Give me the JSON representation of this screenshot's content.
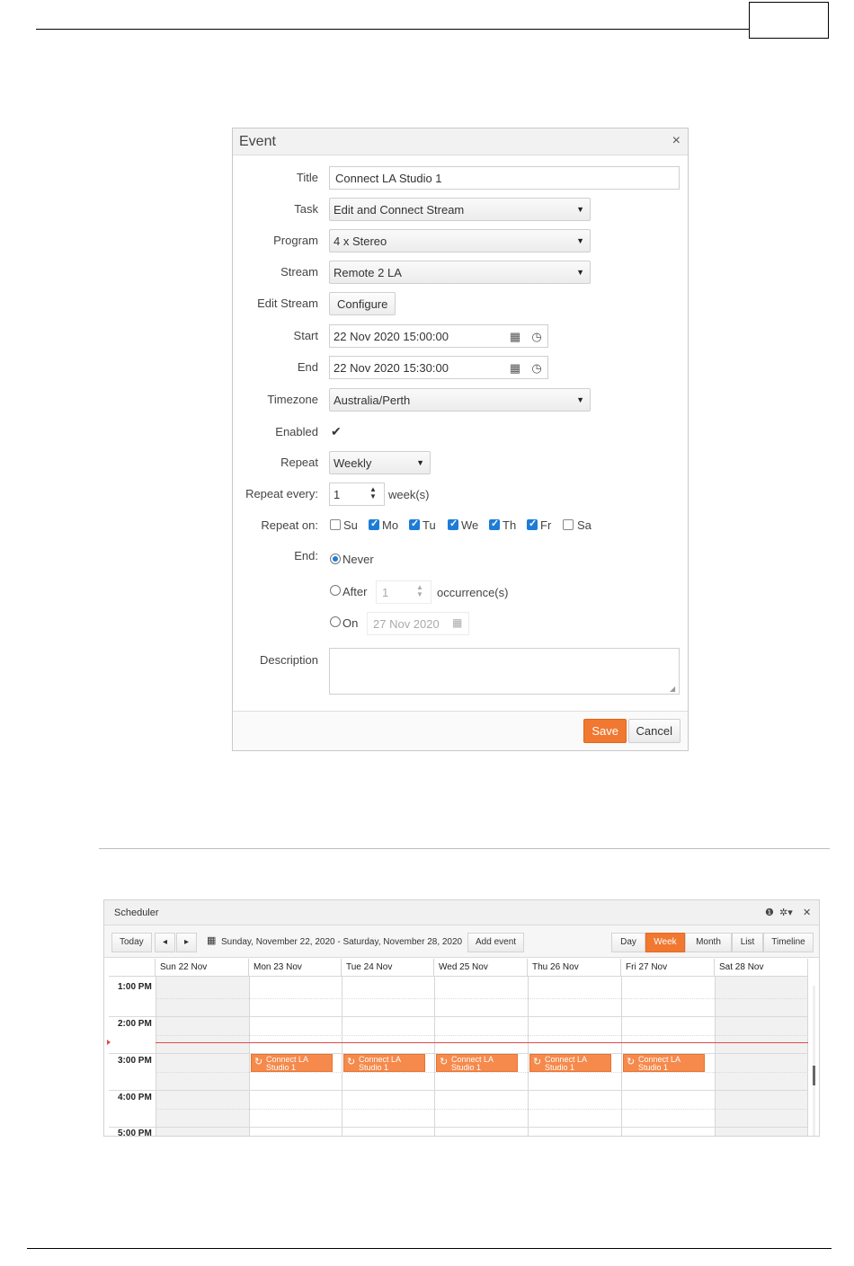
{
  "event_dialog": {
    "title": "Event",
    "close": "×",
    "labels": {
      "title": "Title",
      "task": "Task",
      "program": "Program",
      "stream": "Stream",
      "edit_stream": "Edit Stream",
      "start": "Start",
      "end": "End",
      "timezone": "Timezone",
      "enabled": "Enabled",
      "repeat": "Repeat",
      "repeat_every": "Repeat every:",
      "repeat_on": "Repeat on:",
      "end_rule": "End:",
      "description": "Description"
    },
    "values": {
      "title": "Connect LA Studio 1",
      "task": "Edit and Connect Stream",
      "program": "4 x Stereo",
      "stream": "Remote 2 LA",
      "configure": "Configure",
      "start": "22 Nov 2020 15:00:00",
      "end": "22 Nov 2020 15:30:00",
      "timezone": "Australia/Perth",
      "enabled": true,
      "repeat": "Weekly",
      "repeat_every": "1",
      "repeat_every_unit": "week(s)",
      "end_never": "Never",
      "end_after": "After",
      "end_after_count": "1",
      "end_after_unit": "occurrence(s)",
      "end_on": "On",
      "end_on_date": "27 Nov 2020",
      "description": ""
    },
    "days": [
      {
        "label": "Su",
        "checked": false
      },
      {
        "label": "Mo",
        "checked": true
      },
      {
        "label": "Tu",
        "checked": true
      },
      {
        "label": "We",
        "checked": true
      },
      {
        "label": "Th",
        "checked": true
      },
      {
        "label": "Fr",
        "checked": true
      },
      {
        "label": "Sa",
        "checked": false
      }
    ],
    "buttons": {
      "save": "Save",
      "cancel": "Cancel"
    },
    "colors": {
      "accent": "#f07830",
      "check": "#1e7cd6"
    }
  },
  "scheduler": {
    "title": "Scheduler",
    "toolbar": {
      "today": "Today",
      "range": "Sunday, November 22, 2020 - Saturday, November 28, 2020",
      "add_event": "Add event",
      "views": [
        "Day",
        "Week",
        "Month",
        "List",
        "Timeline"
      ],
      "active_view": "Week"
    },
    "columns": [
      "Sun 22 Nov",
      "Mon 23 Nov",
      "Tue 24 Nov",
      "Wed 25 Nov",
      "Thu 26 Nov",
      "Fri 27 Nov",
      "Sat 28 Nov"
    ],
    "times": [
      "1:00 PM",
      "2:00 PM",
      "3:00 PM",
      "4:00 PM",
      "5:00 PM"
    ],
    "events": [
      {
        "day": "Mon 23 Nov",
        "line1": "Connect LA",
        "line2": "Studio 1"
      },
      {
        "day": "Tue 24 Nov",
        "line1": "Connect LA",
        "line2": "Studio 1"
      },
      {
        "day": "Wed 25 Nov",
        "line1": "Connect LA",
        "line2": "Studio 1"
      },
      {
        "day": "Thu 26 Nov",
        "line1": "Connect LA",
        "line2": "Studio 1"
      },
      {
        "day": "Fri 27 Nov",
        "line1": "Connect LA",
        "line2": "Studio 1"
      }
    ],
    "colors": {
      "event": "#f58a4c",
      "active_view": "#f07830",
      "now_line": "#e04a4a"
    }
  }
}
